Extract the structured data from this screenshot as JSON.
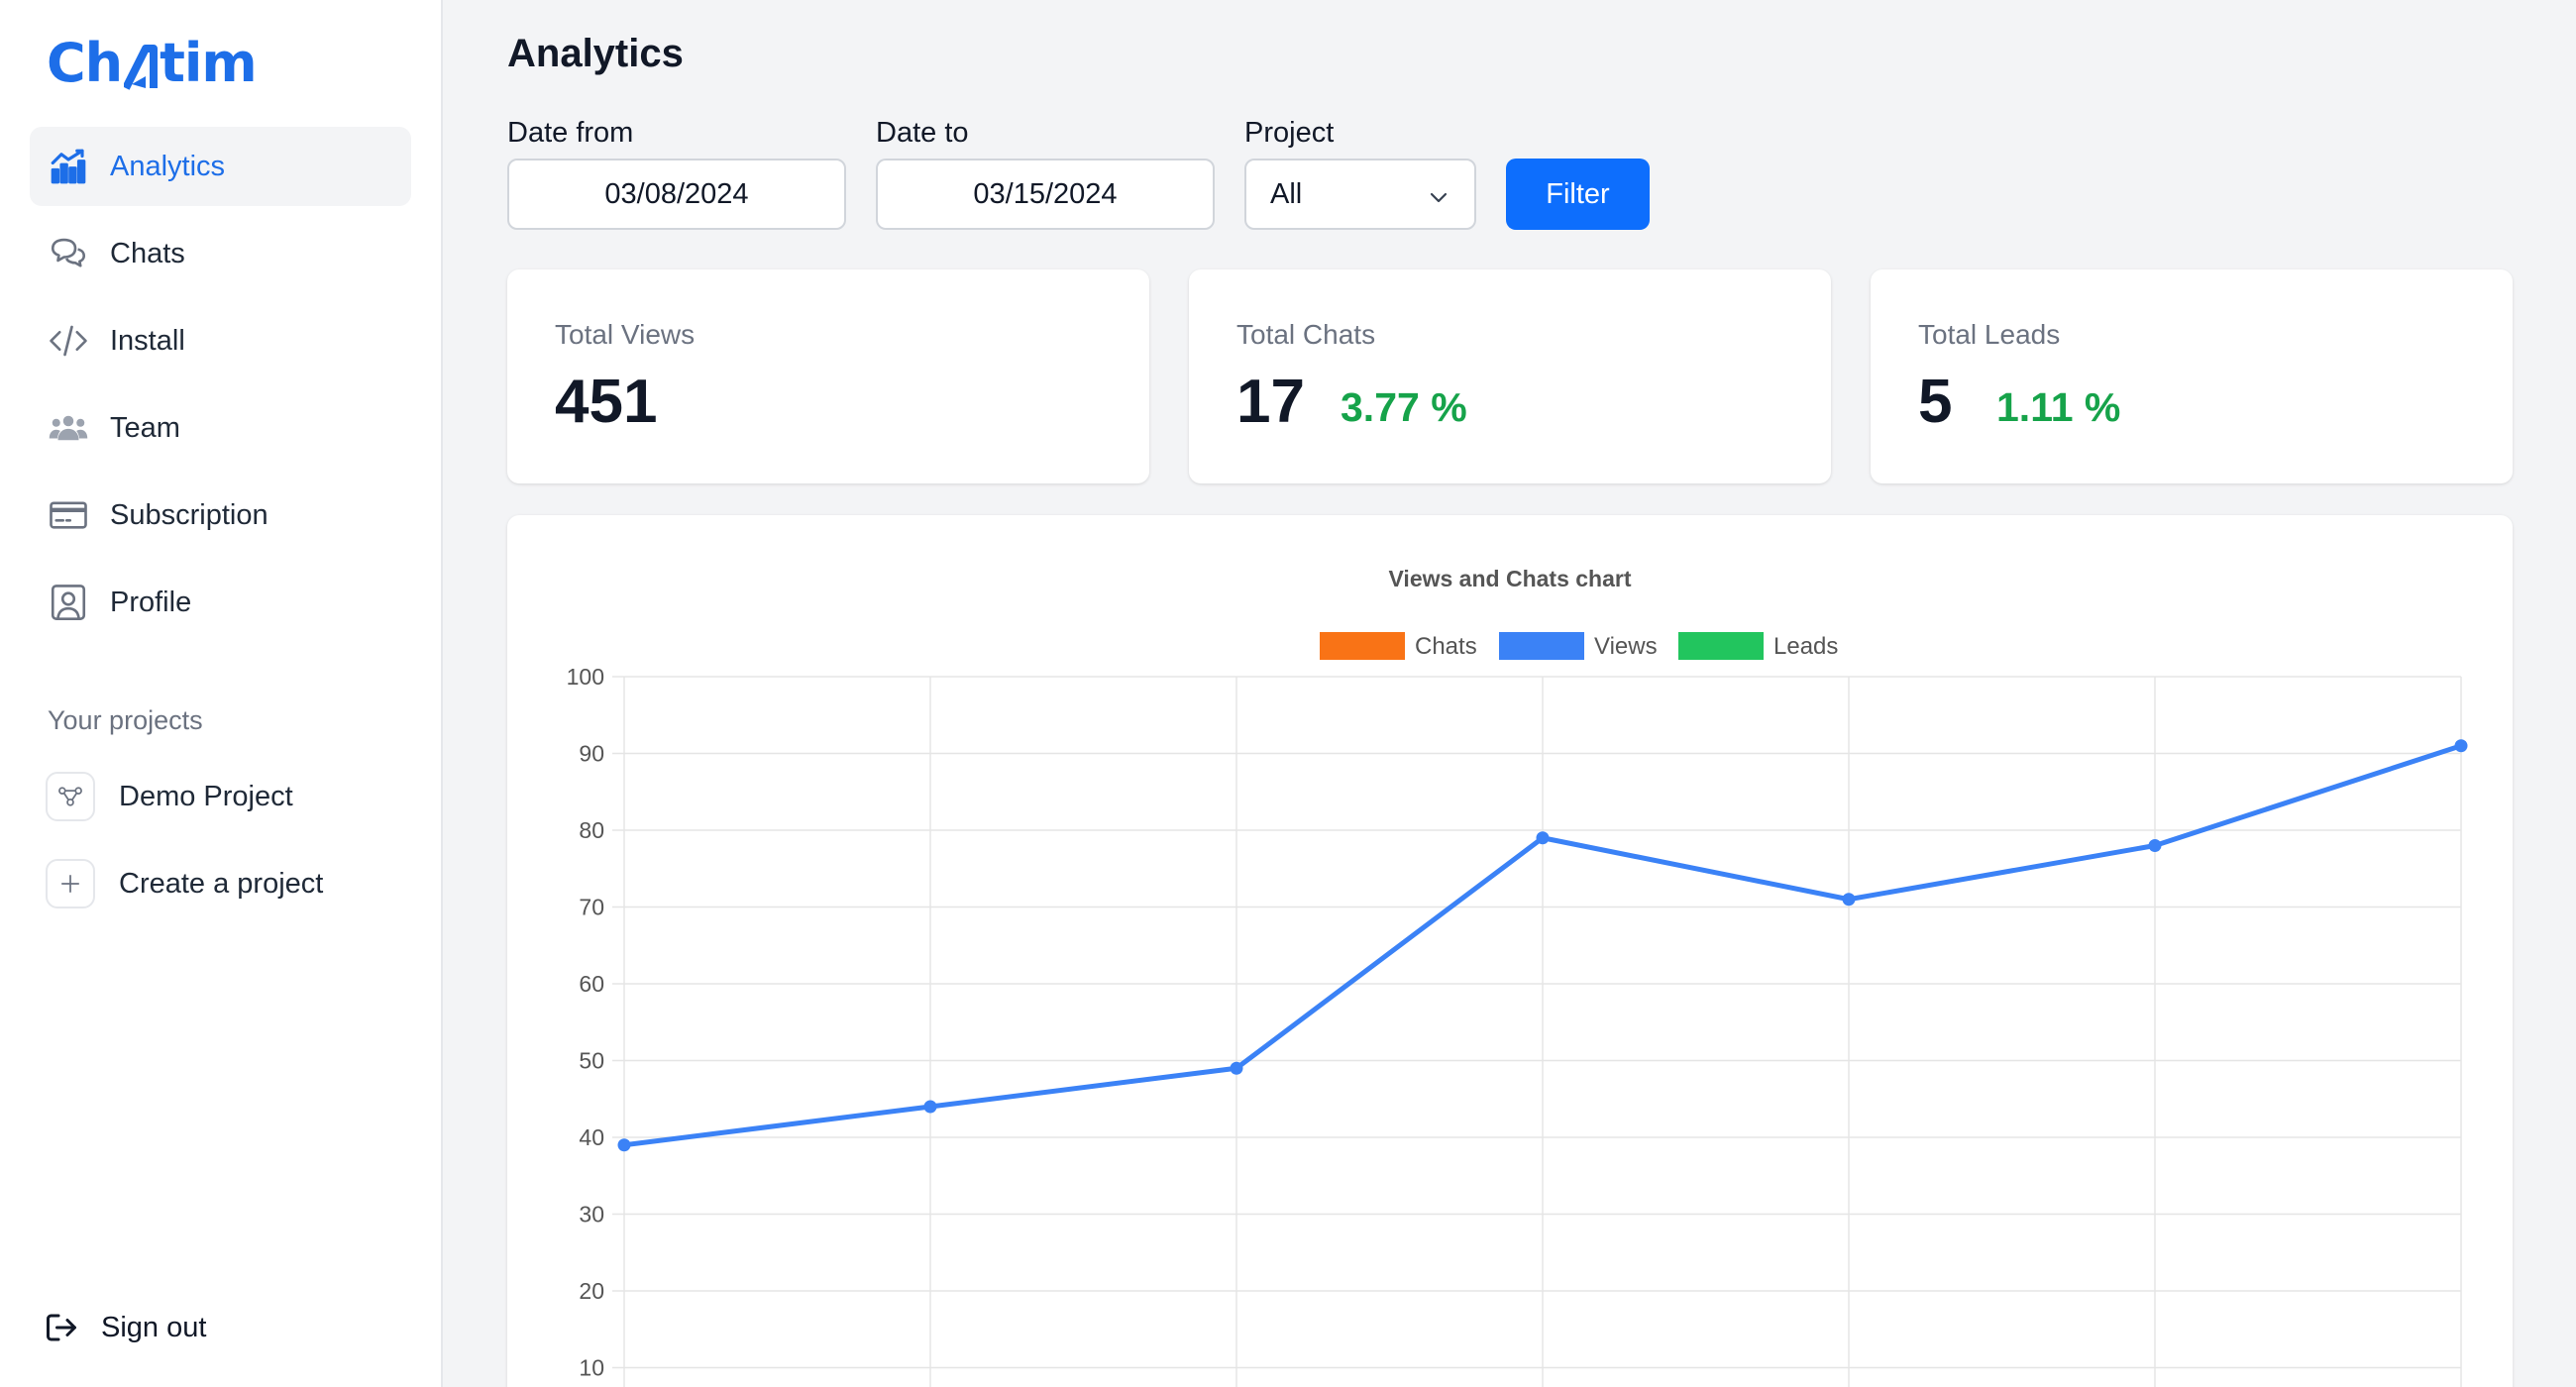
{
  "brand": {
    "name_left": "Ch",
    "name_right": "tim",
    "color": "#1d6ee8"
  },
  "sidebar": {
    "items": [
      {
        "label": "Analytics",
        "icon": "chart-icon",
        "active": true
      },
      {
        "label": "Chats",
        "icon": "chat-bubbles-icon"
      },
      {
        "label": "Install",
        "icon": "code-icon"
      },
      {
        "label": "Team",
        "icon": "team-icon"
      },
      {
        "label": "Subscription",
        "icon": "credit-card-icon"
      },
      {
        "label": "Profile",
        "icon": "user-portrait-icon"
      }
    ],
    "projects_heading": "Your projects",
    "projects": [
      {
        "label": "Demo Project",
        "icon": "project-nodes-icon"
      },
      {
        "label": "Create a project",
        "icon": "plus-icon"
      }
    ],
    "sign_out": "Sign out"
  },
  "page": {
    "title": "Analytics"
  },
  "filters": {
    "date_from_label": "Date from",
    "date_from_value": "03/08/2024",
    "date_to_label": "Date to",
    "date_to_value": "03/15/2024",
    "project_label": "Project",
    "project_value": "All",
    "filter_button": "Filter",
    "button_color": "#0d6efd"
  },
  "stats": [
    {
      "label": "Total Views",
      "value": "451",
      "percent": ""
    },
    {
      "label": "Total Chats",
      "value": "17",
      "percent": "3.77 %"
    },
    {
      "label": "Total Leads",
      "value": "5",
      "percent": "1.11 %"
    }
  ],
  "chart_data": {
    "type": "line",
    "title": "Views and Chats chart",
    "legend": [
      {
        "name": "Chats",
        "color": "#f97316"
      },
      {
        "name": "Views",
        "color": "#3b82f6"
      },
      {
        "name": "Leads",
        "color": "#22c55e"
      }
    ],
    "legend_position": "top",
    "x": [
      0,
      1,
      2,
      3,
      4,
      5,
      6
    ],
    "series": [
      {
        "name": "Views",
        "color": "#3b82f6",
        "values": [
          39,
          44,
          49,
          79,
          71,
          78,
          91
        ]
      }
    ],
    "y_ticks": [
      100,
      90,
      80,
      70,
      60,
      50,
      40,
      30,
      20,
      10
    ],
    "ylim": [
      0,
      100
    ],
    "grid": true
  }
}
